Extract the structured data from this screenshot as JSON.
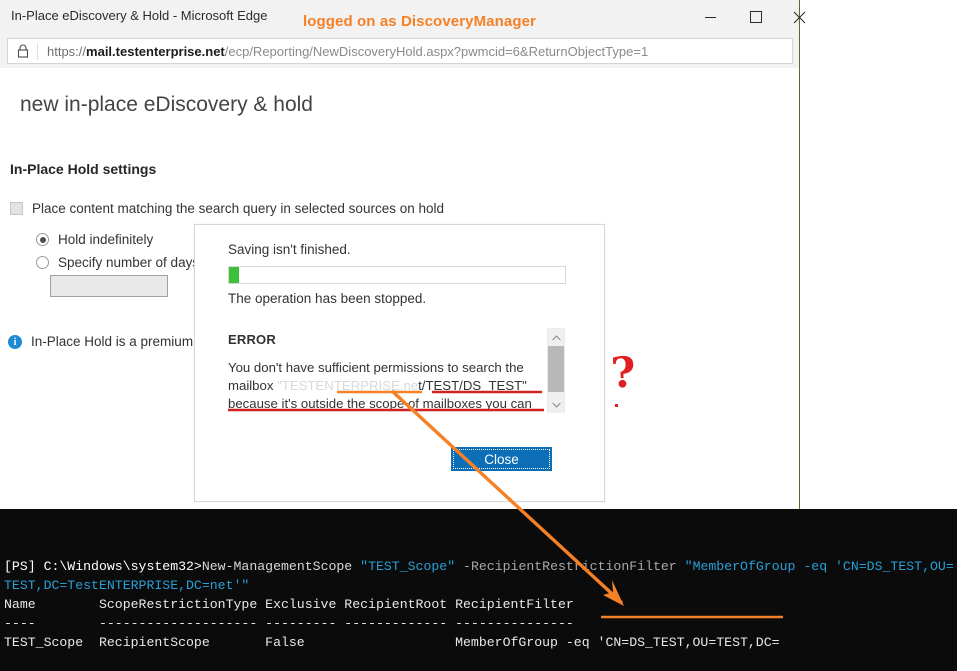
{
  "browser": {
    "window_title": "In-Place eDiscovery & Hold - Microsoft Edge",
    "annotation_logged_on": "logged on as DiscoveryManager",
    "minimize_label": "Minimize",
    "maximize_label": "Maximize",
    "close_label": "Close window",
    "lock_icon": "lock-icon",
    "url_scheme": "https://",
    "url_host": "mail.testenterprise.net",
    "url_path": "/ecp/Reporting/NewDiscoveryHold.aspx?pwmcid=6&ReturnObjectType=1",
    "url_full": "https://mail.testenterprise.net/ecp/Reporting/NewDiscoveryHold.aspx?pwmcid=6&ReturnObjectType=1"
  },
  "page": {
    "title": "new in-place eDiscovery & hold",
    "section_heading": "In-Place Hold settings",
    "checkbox_label": "Place content matching the search query in selected sources on hold",
    "checkbox_checked": false,
    "radio_indefinite_label": "Hold indefinitely",
    "radio_indefinite_selected": true,
    "radio_days_label": "Specify number of days to",
    "radio_days_selected": false,
    "days_input_value": "",
    "days_input_placeholder": "",
    "premium_note": "In-Place Hold is a premium feat",
    "info_icon": "info-icon"
  },
  "dialog": {
    "saving_text": "Saving isn't finished.",
    "progress_percent": 3,
    "progress_color": "#3cc03c",
    "operation_text": "The operation has been stopped.",
    "error_label": "ERROR",
    "error_line_1": "You don't have sufficient permissions to search the mailbox",
    "error_faded_fragment": "\"TESTENTERPRISE.ne",
    "error_line_2_visible": "t/TEST/DS_TEST\" because it's outside",
    "error_line_3": "the scope of mailboxes you can search. To get permissions,",
    "close_button": "Close",
    "scrollbar_up": "▲",
    "scrollbar_down": "▼"
  },
  "annotations": {
    "question_mark": "?",
    "arrow_color": "#F58026",
    "underline_red": "#d42020",
    "underline_orange": "#F58026"
  },
  "console": {
    "prompt": "[PS] C:\\Windows\\system32>",
    "cmdlet": "New-ManagementScope",
    "arg_scope": "\"TEST_Scope\"",
    "param_filter": "-RecipientRestrictionFilter",
    "filter_value_part1": "\"MemberOfGroup -eq 'CN=DS_TEST,OU=",
    "filter_value_part2": "TEST,DC=TestENTERPRISE,DC=net'\"",
    "headers": [
      "Name",
      "ScopeRestrictionType",
      "Exclusive",
      "RecipientRoot",
      "RecipientFilter"
    ],
    "separators": [
      "----",
      "--------------------",
      "---------",
      "-------------",
      "---------------"
    ],
    "row": {
      "name": "TEST_Scope",
      "scope_restriction_type": "RecipientScope",
      "exclusive": "False",
      "recipient_root": "",
      "recipient_filter": "MemberOfGroup -eq 'CN=DS_TEST,OU=TEST,DC="
    }
  }
}
